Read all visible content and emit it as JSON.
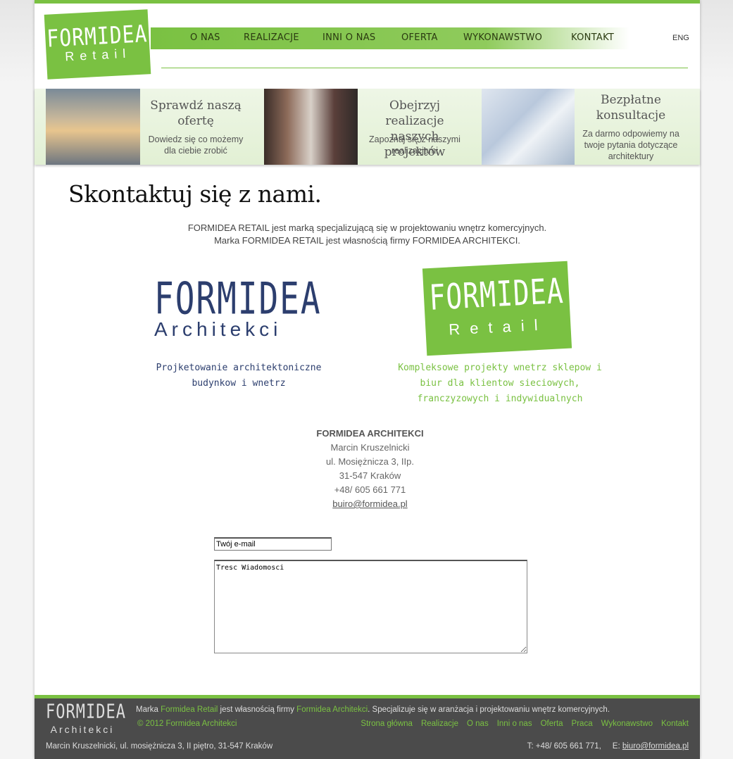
{
  "header": {
    "logo_main": "FORMIDEA",
    "logo_sub": "Retail",
    "nav": [
      "O NAS",
      "REALIZACJE",
      "INNI O NAS",
      "OFERTA",
      "WYKONAWSTWO",
      "KONTAKT"
    ],
    "lang": "ENG"
  },
  "promos": [
    {
      "title": "Sprawdź naszą ofertę",
      "desc": "Dowiedz się co możemy dla ciebie zrobić"
    },
    {
      "title": "Obejrzyj realizacje naszych projektów",
      "desc": "Zapoznaj się z naszymi realizacjami"
    },
    {
      "title": "Bezpłatne konsultacje",
      "desc": "Za darmo odpowiemy na twoje pytania dotyczące architektury"
    }
  ],
  "main": {
    "heading": "Skontaktuj się z nami.",
    "intro_1": "FORMIDEA RETAIL jest marką specjalizującą się w projektowaniu wnętrz komercyjnych.",
    "intro_2": "Marka FORMIDEA RETAIL jest  własnością firmy FORMIDEA ARCHITEKCI.",
    "architekci": {
      "logo_main": "FORMIDEA",
      "logo_sub": "Architekci",
      "tag_1": "Projketowanie architektoniczne",
      "tag_2": "budynkow i wnetrz"
    },
    "retail": {
      "logo_main": "FORMIDEA",
      "logo_sub": "Retail",
      "tag_1": "Kompleksowe projekty wnetrz sklepow i",
      "tag_2": "biur dla klientow sieciowych,",
      "tag_3": "franczyzowych i indywidualnych"
    },
    "address": {
      "company": "FORMIDEA ARCHITEKCI",
      "person": "Marcin Kruszelnicki",
      "street": "ul. Mosiężnicza 3, IIp.",
      "city": "31-547 Kraków",
      "phone": "+48/ 605 661 771",
      "email": "buiro@formidea.pl"
    },
    "form": {
      "email_value": "Twój e-mail",
      "message_value": "Tresc Wiadomosci"
    }
  },
  "footer": {
    "logo_main": "FORMIDEA",
    "logo_sub": "Architekci",
    "text_pre": "Marka ",
    "brand_retail": "Formidea Retail",
    "text_mid": " jest własnością firmy ",
    "brand_arch": "Formidea Architekci",
    "text_post": ". Specjalizuje się w aranżacja i projektowaniu wnętrz komercyjnych.",
    "copyright": "© 2012 Formidea Architekci",
    "nav": [
      "Strona główna",
      "Realizacje",
      "O nas",
      "Inni o nas",
      "Oferta",
      "Praca",
      "Wykonawstwo",
      "Kontakt"
    ],
    "address": "Marcin Kruszelnicki, ul. mosiężnicza 3, II piętro, 31-547 Kraków",
    "phone": "T: +48/ 605 661 771,",
    "email_label": "E:",
    "email": "biuro@formidea.pl"
  },
  "colors": {
    "accent": "#7ac142",
    "navy": "#2c3e6e",
    "footer_bg": "#4b4b4b"
  }
}
